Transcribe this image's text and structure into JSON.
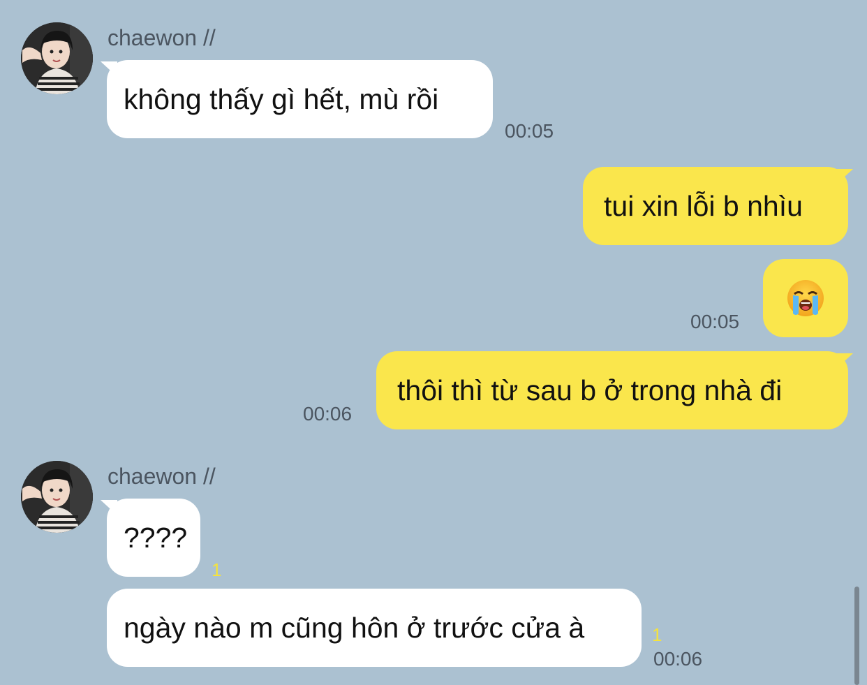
{
  "messages": [
    {
      "sender": "chaewon //",
      "text": "không thấy gì hết, mù rồi",
      "time": "00:05"
    },
    {
      "text": "tui xin lỗi b nhìu"
    },
    {
      "emoji": "loudly-crying-face",
      "time": "00:05"
    },
    {
      "text": "thôi thì từ sau b ở trong nhà đi",
      "time": "00:06"
    },
    {
      "sender": "chaewon //",
      "text": "????",
      "unread": "1"
    },
    {
      "text": "ngày nào m cũng hôn ở trước cửa à",
      "unread": "1",
      "time": "00:06"
    }
  ],
  "colors": {
    "background": "#abc1d1",
    "incoming_bubble": "#ffffff",
    "outgoing_bubble": "#fae64c",
    "unread_count": "#f5e33b",
    "meta_text": "#4b5560"
  }
}
